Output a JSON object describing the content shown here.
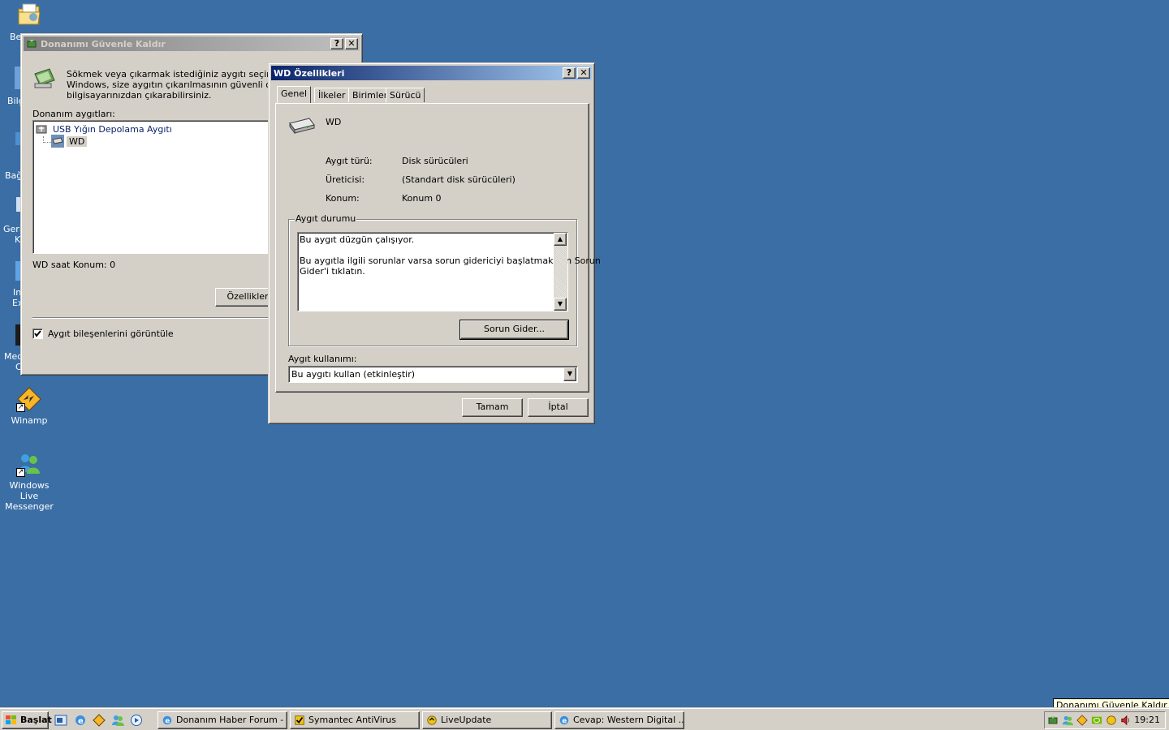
{
  "desktop": {
    "icons": [
      {
        "label": "Winamp"
      },
      {
        "label": "Windows Live Messenger"
      }
    ],
    "fragments": [
      "Be",
      "Bilg",
      "Bağ",
      "Geri",
      "K",
      "In",
      "Ex",
      "Med",
      "C"
    ]
  },
  "remove_hw_window": {
    "title": "Donanımı Güvenle Kaldır",
    "description": "Sökmek veya çıkarmak istediğiniz aygıtı seçin ve Dur Windows, size aygıtın çıkarılmasının güvenli olduğunu bilgisayarınızdan çıkarabilirsiniz.",
    "description_lines": [
      "Sökmek veya çıkarmak istediğiniz aygıtı seçin ve Dur",
      "Windows, size aygıtın çıkarılmasının güvenli olduğunu",
      "bilgisayarınızdan çıkarabilirsiniz."
    ],
    "devices_label": "Donanım aygıtları:",
    "tree": [
      {
        "label": "USB Yığın Depolama Aygıtı"
      },
      {
        "label": "WD"
      }
    ],
    "status_text": "WD  saat Konum: 0",
    "properties_button": "Özellikler",
    "show_components_checkbox": {
      "label": "Aygıt bileşenlerini görüntüle",
      "checked": true
    }
  },
  "props_window": {
    "title": "WD  Özellikleri",
    "tabs": [
      "Genel",
      "İlkeler",
      "Birimler",
      "Sürücü"
    ],
    "selected_tab": "Genel",
    "device_name": "WD",
    "fields": [
      {
        "label": "Aygıt türü:",
        "value": "Disk sürücüleri"
      },
      {
        "label": "Üreticisi:",
        "value": "(Standart disk sürücüleri)"
      },
      {
        "label": "Konum:",
        "value": "Konum 0"
      }
    ],
    "status_group": {
      "title": "Aygıt durumu",
      "line1": "Bu aygıt düzgün çalışıyor.",
      "line2": "Bu aygıtla ilgili sorunlar varsa sorun gidericiyi başlatmak için Sorun",
      "line3": "Gider'i tıklatın.",
      "troubleshoot_button": "Sorun Gider..."
    },
    "usage_label": "Aygıt kullanımı:",
    "usage_value": "Bu aygıtı kullan (etkinleştir)",
    "ok_button": "Tamam",
    "cancel_button": "İptal"
  },
  "taskbar": {
    "start_label": "Başlat",
    "tasks": [
      {
        "label": "Donanım Haber Forum - ..."
      },
      {
        "label": "Symantec AntiVirus"
      },
      {
        "label": "LiveUpdate"
      },
      {
        "label": "Cevap: Western Digital ..."
      }
    ],
    "clock": "19:21",
    "tooltip": "Donanımı Güvenle Kaldır"
  },
  "colors": {
    "desktop": "#3a6ea5",
    "active_title_start": "#0a246a",
    "active_title_end": "#a6caf0",
    "face": "#d4d0c8"
  },
  "icons": [
    "folder-icon",
    "safely-remove-hardware-icon",
    "usb-icon",
    "disk-drive-icon",
    "winamp-icon",
    "messenger-icon",
    "ie-icon",
    "help-icon",
    "close-icon",
    "checkbox-check-icon",
    "dropdown-arrow-icon",
    "windows-logo-icon",
    "speaker-icon"
  ]
}
